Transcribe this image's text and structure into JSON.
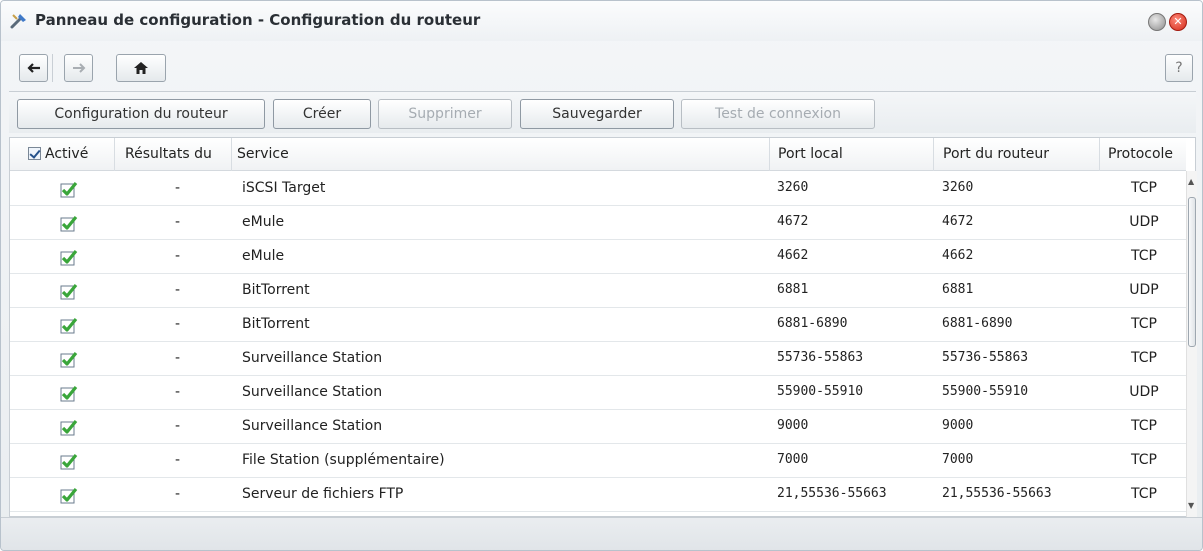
{
  "window": {
    "title": "Panneau de configuration - Configuration du routeur",
    "close_glyph": "✕"
  },
  "nav": {
    "back_icon": "arrow-left-icon",
    "forward_icon": "arrow-right-icon",
    "home_icon": "home-icon",
    "help_label": "?"
  },
  "toolbar": {
    "router_config": "Configuration du routeur",
    "create": "Créer",
    "delete": "Supprimer",
    "save": "Sauvegarder",
    "test": "Test de connexion"
  },
  "table": {
    "headers": {
      "enabled": "Activé",
      "results": "Résultats du",
      "service": "Service",
      "local_port": "Port local",
      "router_port": "Port du routeur",
      "protocol": "Protocole"
    },
    "rows": [
      {
        "result": "-",
        "service": "iSCSI Target",
        "local": "3260",
        "router": "3260",
        "proto": "TCP"
      },
      {
        "result": "-",
        "service": "eMule",
        "local": "4672",
        "router": "4672",
        "proto": "UDP"
      },
      {
        "result": "-",
        "service": "eMule",
        "local": "4662",
        "router": "4662",
        "proto": "TCP"
      },
      {
        "result": "-",
        "service": "BitTorrent",
        "local": "6881",
        "router": "6881",
        "proto": "UDP"
      },
      {
        "result": "-",
        "service": "BitTorrent",
        "local": "6881-6890",
        "router": "6881-6890",
        "proto": "TCP"
      },
      {
        "result": "-",
        "service": "Surveillance Station",
        "local": "55736-55863",
        "router": "55736-55863",
        "proto": "TCP"
      },
      {
        "result": "-",
        "service": "Surveillance Station",
        "local": "55900-55910",
        "router": "55900-55910",
        "proto": "UDP"
      },
      {
        "result": "-",
        "service": "Surveillance Station",
        "local": "9000",
        "router": "9000",
        "proto": "TCP"
      },
      {
        "result": "-",
        "service": "File Station (supplémentaire)",
        "local": "7000",
        "router": "7000",
        "proto": "TCP"
      },
      {
        "result": "-",
        "service": "Serveur de fichiers FTP",
        "local": "21,55536-55663",
        "router": "21,55536-55663",
        "proto": "TCP"
      }
    ]
  },
  "colors": {
    "check_green": "#3aa63a",
    "accent_blue": "#24518b"
  }
}
